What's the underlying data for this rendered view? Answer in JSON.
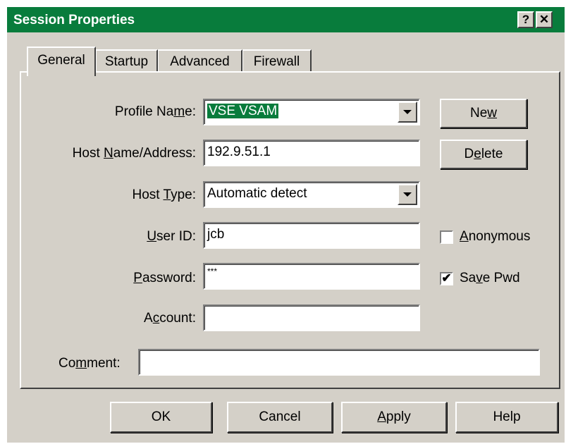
{
  "window": {
    "title": "Session Properties",
    "help_button": "?",
    "close_button": "✕",
    "titlebar_color": "#087c3c"
  },
  "tabs": [
    {
      "label": "General",
      "active": true
    },
    {
      "label": "Startup",
      "active": false
    },
    {
      "label": "Advanced",
      "active": false
    },
    {
      "label": "Firewall",
      "active": false
    }
  ],
  "form": {
    "profile_name": {
      "label": "Profile Name:",
      "value": "VSE VSAM"
    },
    "host_name": {
      "label": "Host Name/Address:",
      "value": "192.9.51.1"
    },
    "host_type": {
      "label": "Host Type:",
      "value": "Automatic detect"
    },
    "user_id": {
      "label": "User ID:",
      "value": "jcb"
    },
    "password": {
      "label": "Password:",
      "value": "***"
    },
    "account": {
      "label": "Account:",
      "value": ""
    },
    "comment": {
      "label": "Comment:",
      "value": ""
    }
  },
  "side_buttons": {
    "new": "New",
    "delete": "Delete"
  },
  "checkboxes": {
    "anonymous": {
      "label": "Anonymous",
      "checked": false
    },
    "save_pwd": {
      "label": "Save Pwd",
      "checked": true,
      "mark": "✔"
    }
  },
  "footer": {
    "ok": "OK",
    "cancel": "Cancel",
    "apply": "Apply",
    "help": "Help"
  }
}
